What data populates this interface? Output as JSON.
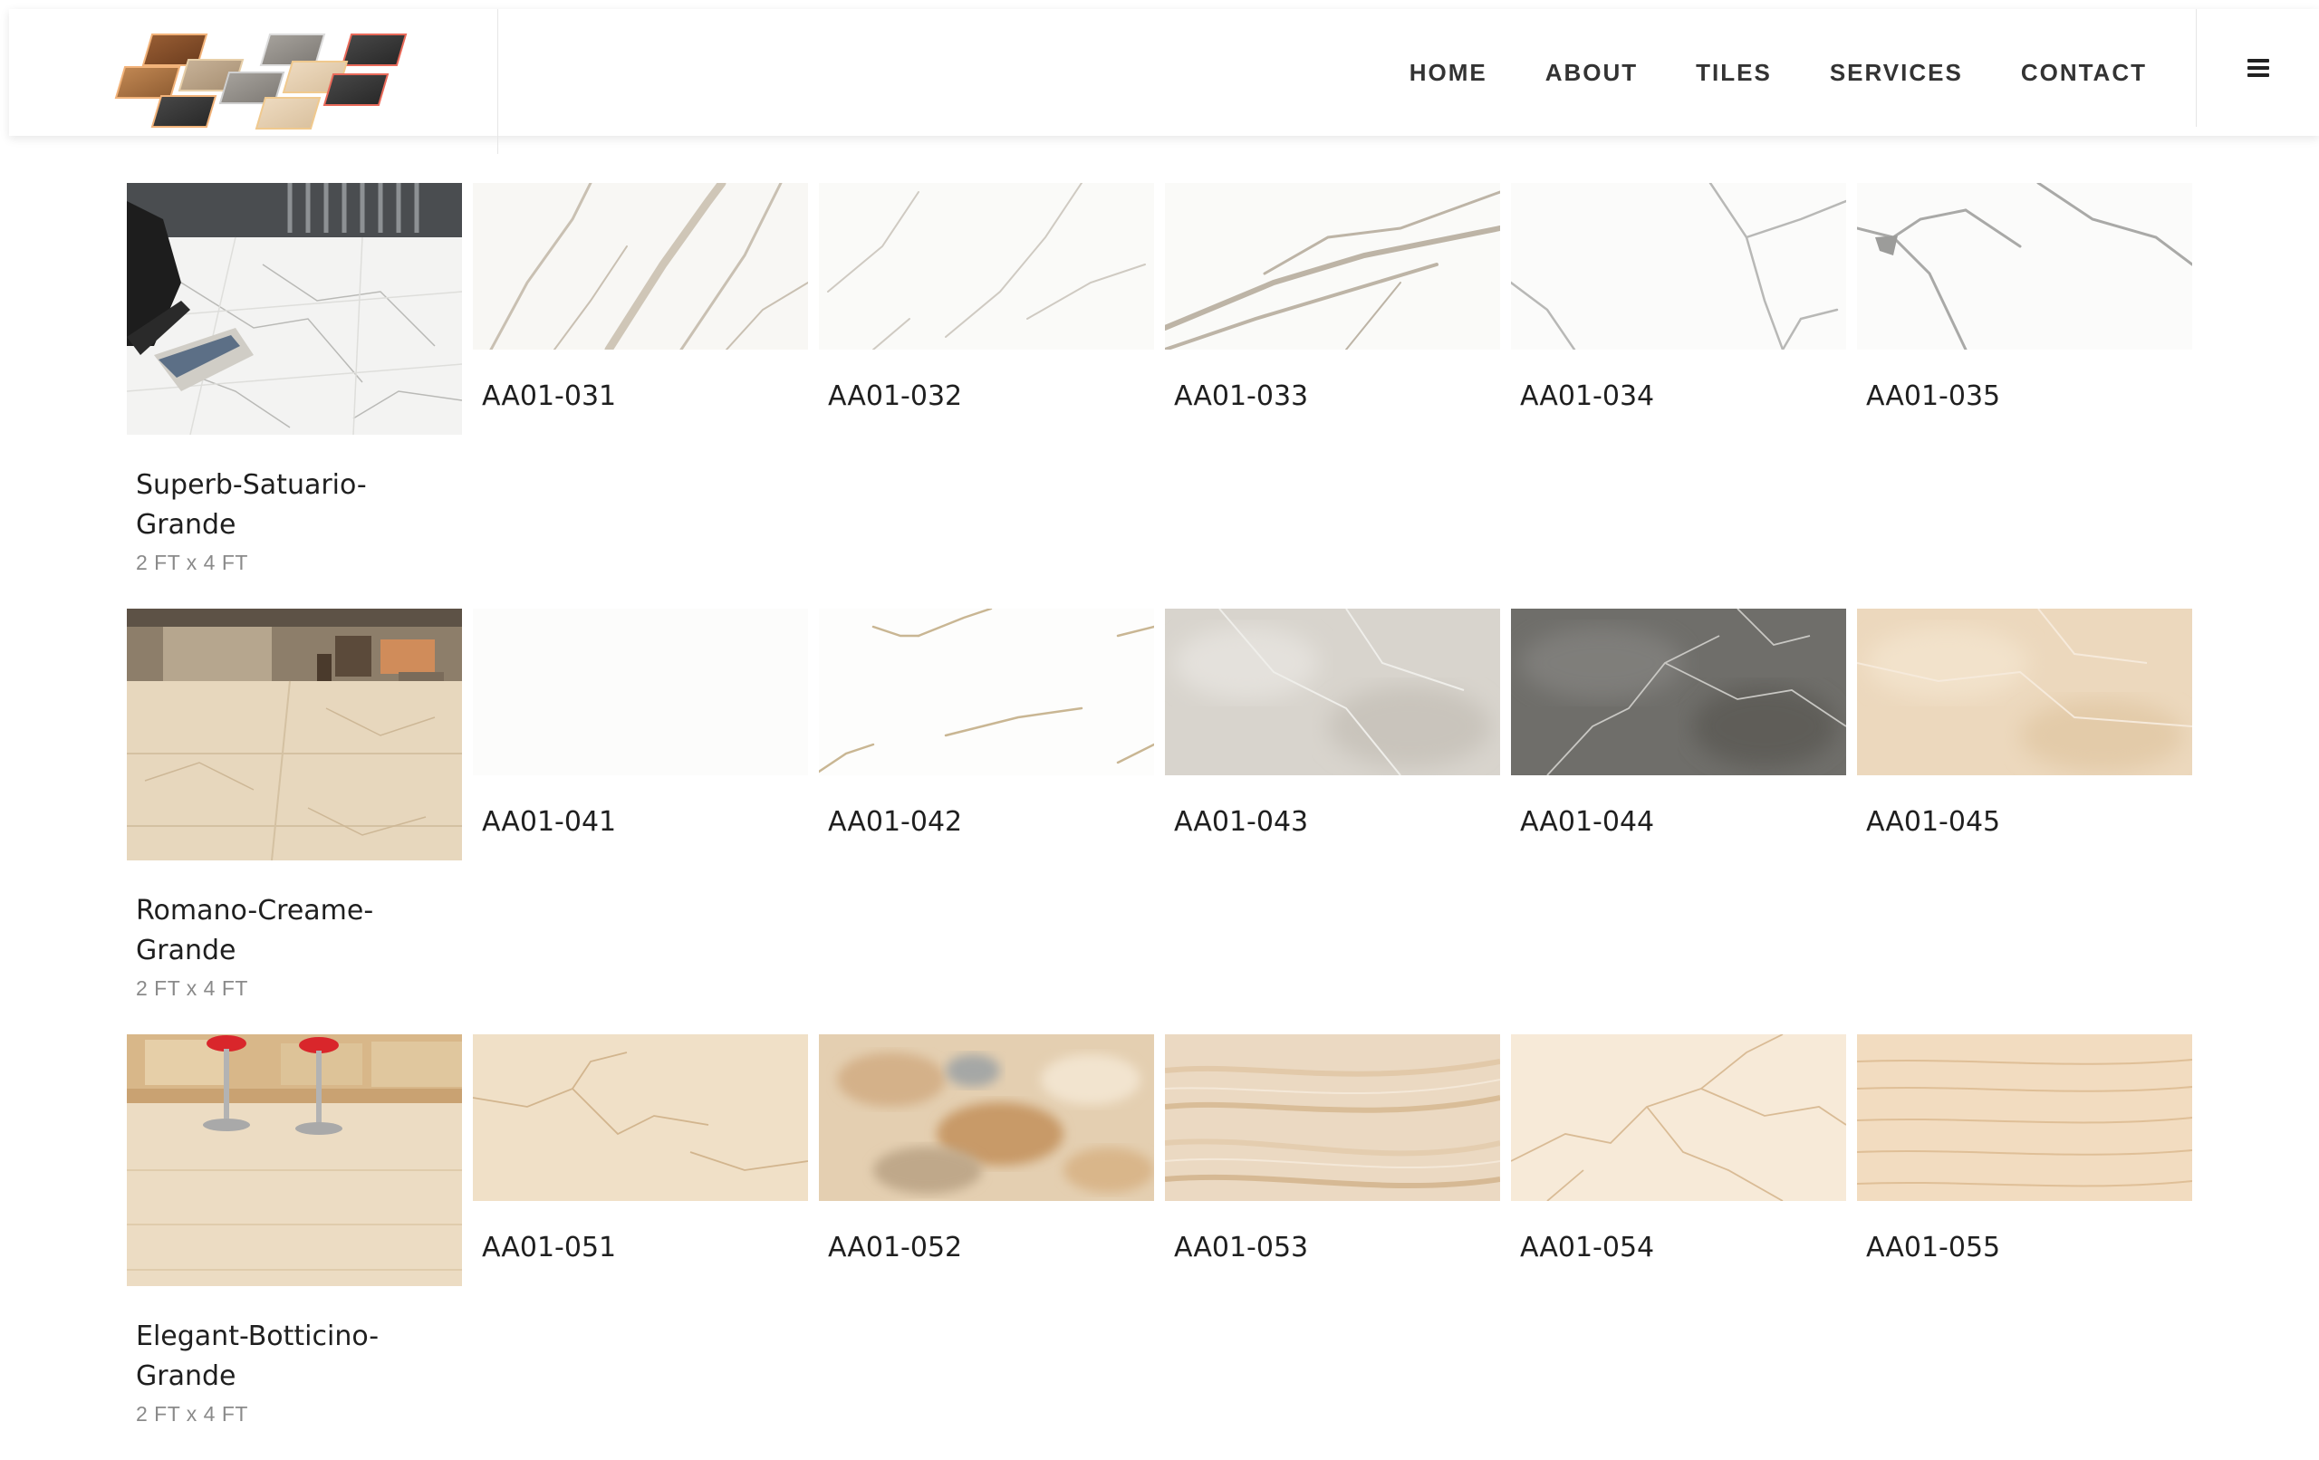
{
  "nav": {
    "items": [
      "HOME",
      "ABOUT",
      "TILES",
      "SERVICES",
      "CONTACT"
    ]
  },
  "icons": {
    "logo": "tile-swatches-logo",
    "menu": "hamburger-menu-icon"
  },
  "catalog": {
    "rows": [
      {
        "series": "Superb-Satuario-Grande",
        "series_line1": "Superb-Satuario-",
        "series_line2": "Grande",
        "size": "2 FT x 4 FT",
        "codes": [
          "AA01-031",
          "AA01-032",
          "AA01-033",
          "AA01-034",
          "AA01-035"
        ]
      },
      {
        "series": "Romano-Creame-Grande",
        "series_line1": "Romano-Creame-",
        "series_line2": "Grande",
        "size": "2 FT x 4 FT",
        "codes": [
          "AA01-041",
          "AA01-042",
          "AA01-043",
          "AA01-044",
          "AA01-045"
        ]
      },
      {
        "series": "Elegant-Botticino-Grande",
        "series_line1": "Elegant-Botticino-",
        "series_line2": "Grande",
        "size": "2 FT x 4 FT",
        "codes": [
          "AA01-051",
          "AA01-052",
          "AA01-053",
          "AA01-054",
          "AA01-055"
        ]
      }
    ]
  },
  "colors": {
    "text": "#1f1f1f",
    "muted": "#8a8a8a",
    "white_marble": "#f7f6f3",
    "cream_marble": "#ecdcc3",
    "grey_marble": "#d9d6d1",
    "dark_marble": "#6e6d69",
    "beige_marble": "#f0e0c9"
  }
}
